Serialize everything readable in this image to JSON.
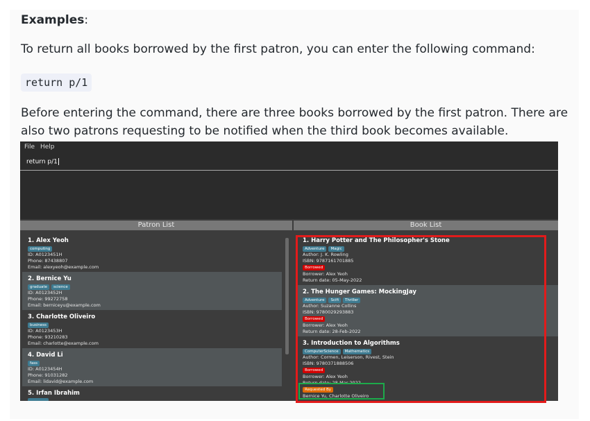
{
  "doc": {
    "examples_heading": "Examples",
    "examples_colon": ":",
    "intro": "To return all books borrowed by the first patron, you can enter the following command:",
    "command": "return p/1",
    "description": "Before entering the command, there are three books borrowed by the first patron. There are also two patrons requesting to be notified when the third book becomes available."
  },
  "app": {
    "menu": {
      "file": "File",
      "help": "Help"
    },
    "command_input": "return p/1",
    "patron_list_header": "Patron List",
    "book_list_header": "Book List",
    "patrons": [
      {
        "title": "1.  Alex Yeoh",
        "tags": [
          "computing"
        ],
        "id": "ID: A0123451H",
        "phone": "Phone: 87438807",
        "email": "Email: alexyeoh@example.com"
      },
      {
        "title": "2.  Bernice Yu",
        "tags": [
          "graduate",
          "science"
        ],
        "id": "ID: A0123452H",
        "phone": "Phone: 99272758",
        "email": "Email: berniceyu@example.com"
      },
      {
        "title": "3.  Charlotte Oliveiro",
        "tags": [
          "business"
        ],
        "id": "ID: A0123453H",
        "phone": "Phone: 93210283",
        "email": "Email: charlotte@example.com"
      },
      {
        "title": "4.  David Li",
        "tags": [
          "fass"
        ],
        "id": "ID: A0123454H",
        "phone": "Phone: 91031282",
        "email": "Email: lidavid@example.com"
      },
      {
        "title": "5.  Irfan Ibrahim"
      }
    ],
    "books": [
      {
        "title": "1.  Harry Potter and The Philosopher's Stone",
        "tags": [
          "Adventure",
          "Magic"
        ],
        "author": "Author: J. K. Rowling",
        "isbn": "ISBN: 9787161701885",
        "status": "Borrowed",
        "borrower": "Borrower: Alex Yeoh",
        "return_date": "Return date: 05-May-2022"
      },
      {
        "title": "2.  The Hunger Games: MockingJay",
        "tags": [
          "Adventure",
          "Scifi",
          "Thriller"
        ],
        "author": "Author: Suzanne Collins",
        "isbn": "ISBN: 9780029293883",
        "status": "Borrowed",
        "borrower": "Borrower: Alex Yeoh",
        "return_date": "Return date: 28-Feb-2022"
      },
      {
        "title": "3.  Introduction to Algorithms",
        "tags": [
          "ComputerScience",
          "Mathematics"
        ],
        "author": "Author: Cormen, Leiserson, Rivest, Stein",
        "isbn": "ISBN: 9780371888506",
        "status": "Borrowed",
        "borrower": "Borrower: Alex Yeoh",
        "return_date": "Return date: 28-Mar-2022",
        "requested_label": "Requested By",
        "requesters": "Bernice Yu, Charlotte Oliveiro"
      }
    ]
  },
  "colors": {
    "highlight_red": "#e21b1b",
    "highlight_green": "#1daa4a",
    "tag": "#3e7b91",
    "borrowed_badge": "#d50000",
    "requested_badge": "#e06b08"
  }
}
